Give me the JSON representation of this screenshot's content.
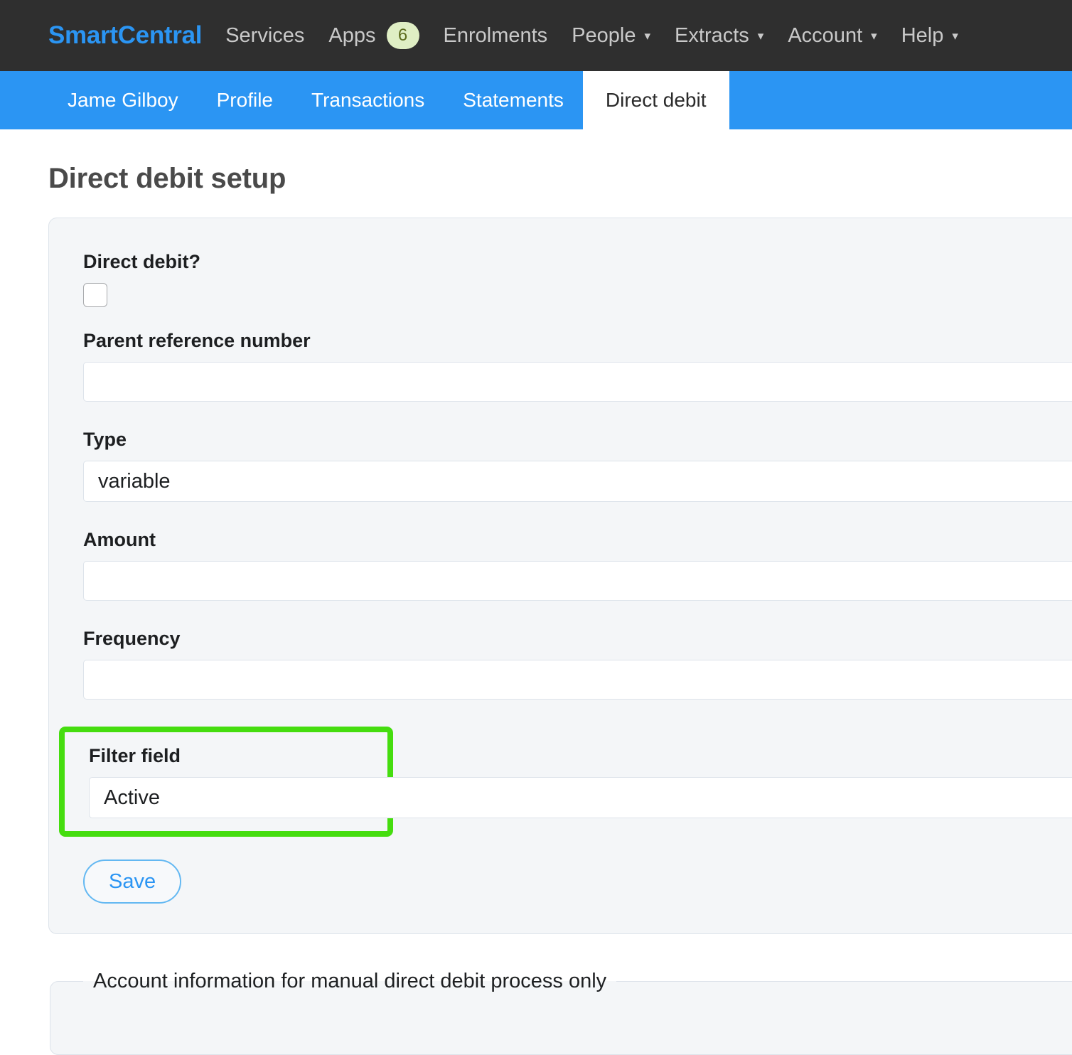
{
  "navbar": {
    "brand": "SmartCentral",
    "items": [
      {
        "label": "Services",
        "badge": null,
        "caret": false
      },
      {
        "label": "Apps",
        "badge": "6",
        "caret": false
      },
      {
        "label": "Enrolments",
        "badge": null,
        "caret": false
      },
      {
        "label": "People",
        "badge": null,
        "caret": true
      },
      {
        "label": "Extracts",
        "badge": null,
        "caret": true
      },
      {
        "label": "Account",
        "badge": null,
        "caret": true
      },
      {
        "label": "Help",
        "badge": null,
        "caret": true
      }
    ],
    "caret_glyph": "▾"
  },
  "tabs": [
    {
      "label": "Jame Gilboy",
      "active": false
    },
    {
      "label": "Profile",
      "active": false
    },
    {
      "label": "Transactions",
      "active": false
    },
    {
      "label": "Statements",
      "active": false
    },
    {
      "label": "Direct debit",
      "active": true
    }
  ],
  "page": {
    "title": "Direct debit setup"
  },
  "form": {
    "direct_debit": {
      "label": "Direct debit?",
      "checked": false
    },
    "parent_reference_number": {
      "label": "Parent reference number",
      "value": "",
      "placeholder": ""
    },
    "type": {
      "label": "Type",
      "value": "variable"
    },
    "amount": {
      "label": "Amount",
      "value": "",
      "placeholder": ""
    },
    "frequency": {
      "label": "Frequency",
      "value": "",
      "placeholder": ""
    },
    "filter_field": {
      "label": "Filter field",
      "value": "Active",
      "highlighted": true
    },
    "save_label": "Save"
  },
  "account_section": {
    "legend": "Account information for manual direct debit process only"
  },
  "colors": {
    "navbar_bg": "#2f2f2f",
    "brand": "#2b95f3",
    "tabbar_bg": "#2b95f3",
    "highlight": "#45dd0f",
    "badge_bg": "#dfeec4",
    "badge_text": "#5c6b1d",
    "panel_bg": "#f4f6f8",
    "save_text": "#2b95f3"
  }
}
